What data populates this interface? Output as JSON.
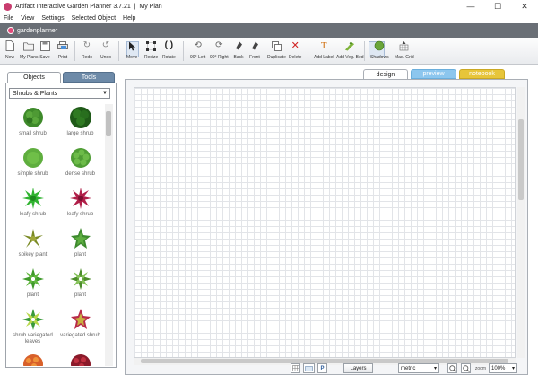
{
  "window": {
    "title": "Artifact Interactive Garden Planner 3.7.21  |  My Plan",
    "minimize": "—",
    "maximize": "☐",
    "close": "✕"
  },
  "menu": [
    "File",
    "View",
    "Settings",
    "Selected Object",
    "Help"
  ],
  "brand": {
    "logo_text": "gardenplanner",
    "accent": "#e24a7a"
  },
  "toolbar": [
    {
      "label": "New",
      "icon": "new-file-icon"
    },
    {
      "label": "My Plans",
      "icon": "folder-icon"
    },
    {
      "label": "Save",
      "icon": "save-icon"
    },
    {
      "label": "Print",
      "icon": "printer-icon"
    },
    {
      "label": "Redo",
      "icon": "redo-icon"
    },
    {
      "label": "Undo",
      "icon": "undo-icon"
    },
    {
      "label": "Move",
      "icon": "move-arrow-icon"
    },
    {
      "label": "Resize",
      "icon": "resize-icon"
    },
    {
      "label": "Rotate",
      "icon": "rotate-icon"
    },
    {
      "label": "90° Left",
      "icon": "rotate-left-icon"
    },
    {
      "label": "90° Right",
      "icon": "rotate-right-icon"
    },
    {
      "label": "Back",
      "icon": "send-back-icon"
    },
    {
      "label": "Front",
      "icon": "bring-front-icon"
    },
    {
      "label": "Duplicate",
      "icon": "duplicate-icon"
    },
    {
      "label": "Delete",
      "icon": "delete-icon"
    },
    {
      "label": "Add Label",
      "icon": "text-label-icon"
    },
    {
      "label": "Add Veg. Bed",
      "icon": "veg-bed-icon"
    },
    {
      "label": "Shadows",
      "icon": "shadows-icon"
    },
    {
      "label": "Max. Grid",
      "icon": "grid-icon"
    }
  ],
  "left_tabs": {
    "objects": "Objects",
    "tools": "Tools"
  },
  "category": {
    "selected": "Shrubs & Plants",
    "arrow": "▼"
  },
  "plants": [
    {
      "label": "small shrub",
      "icon": "small-shrub-icon"
    },
    {
      "label": "large shrub",
      "icon": "large-shrub-icon"
    },
    {
      "label": "simple shrub",
      "icon": "simple-shrub-icon"
    },
    {
      "label": "dense shrub",
      "icon": "dense-shrub-icon"
    },
    {
      "label": "leafy shrub",
      "icon": "leafy-shrub-green-icon"
    },
    {
      "label": "leafy shrub",
      "icon": "leafy-shrub-red-icon"
    },
    {
      "label": "spikey plant",
      "icon": "spikey-plant-icon"
    },
    {
      "label": "plant",
      "icon": "plant-star-icon"
    },
    {
      "label": "plant",
      "icon": "plant-green-icon"
    },
    {
      "label": "plant",
      "icon": "plant-light-icon"
    },
    {
      "label": "shrub variegated leaves",
      "icon": "variegated-leaves-icon"
    },
    {
      "label": "variegated shrub",
      "icon": "variegated-shrub-icon"
    },
    {
      "label": "",
      "icon": "orange-flower-icon"
    },
    {
      "label": "",
      "icon": "red-flower-icon"
    }
  ],
  "view_tabs": {
    "design": "design",
    "preview": "preview",
    "notebook": "notebook"
  },
  "status": {
    "layers": "Layers",
    "units": "metric",
    "zoom_label": "zoom",
    "zoom_value": "100%",
    "arrow": "▾"
  }
}
